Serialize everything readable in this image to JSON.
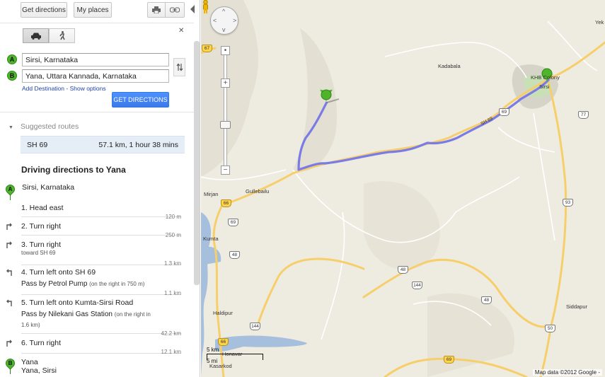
{
  "toolbar": {
    "get_directions": "Get directions",
    "my_places": "My places",
    "print_icon": "printer-icon",
    "link_icon": "link-icon",
    "collapse_icon": "chevron-left-icon"
  },
  "travel_modes": [
    "car-icon",
    "walk-icon"
  ],
  "close_label": "✕",
  "inputs": {
    "origin_marker": "A",
    "destination_marker": "B",
    "origin": "Sirsi, Karnataka",
    "destination": "Yana, Uttara Kannada, Karnataka",
    "add_destination": "Add Destination",
    "separator": " - ",
    "show_options": "Show options",
    "submit": "GET DIRECTIONS"
  },
  "suggested": {
    "heading": "Suggested routes",
    "route_name": "SH 69",
    "route_summary": "57.1 km, 1 hour 38 mins"
  },
  "directions": {
    "title": "Driving directions to Yana",
    "origin": "Sirsi, Karnataka",
    "steps": [
      {
        "text": "1. Head east",
        "dist": "120 m"
      },
      {
        "text": "2. Turn right",
        "dist": "250 m"
      },
      {
        "text": "3. Turn right",
        "note": "toward SH 69",
        "dist": "1.3 km"
      },
      {
        "text": "4. Turn left onto SH 69",
        "pass": "Pass by Petrol Pump",
        "pass_note": "(on the right in 750 m)",
        "dist": "1.1 km"
      },
      {
        "text": "5. Turn left onto Kumta-Sirsi Road",
        "pass": "Pass by Nilekani Gas Station",
        "pass_note": "(on the right in",
        "pass_note2": "1.6 km)",
        "dist": "42.2 km"
      },
      {
        "text": "6. Turn right",
        "dist": "12.1 km"
      }
    ],
    "destination_line1": "Yana",
    "destination_line2": "Yana, Sirsi"
  },
  "map": {
    "places": {
      "kadabala": "Kadabala",
      "khb_colony": "KHB Colony",
      "sirsi": "Sirsi",
      "yek": "Yek",
      "mirjan": "Mirjan",
      "gullebailu": "Gullebailu",
      "kumta": "Kumta",
      "haldipur": "Haldipur",
      "honavar": "Honavar",
      "kasarkod": "Kasarkod",
      "siddapur": "Siddapur"
    },
    "shields": {
      "s67": "67",
      "s66a": "66",
      "s69a": "69",
      "s48a": "48",
      "s66b": "66",
      "s69b": "69",
      "s77": "77",
      "s93": "93",
      "s48b": "48",
      "s144a": "144",
      "s48c": "48",
      "s50": "50",
      "s144b": "144",
      "s69c": "69",
      "s69d": "69"
    },
    "road_label": "SH 69",
    "marker_a": "A",
    "marker_b": "B",
    "scale_km": "5 km",
    "scale_mi": "5 mi",
    "attribution": "Map data ©2012 Google -",
    "route_color": "#7b7be6",
    "water_color": "#a5bfdd",
    "highway_color": "#f6cf6a"
  }
}
